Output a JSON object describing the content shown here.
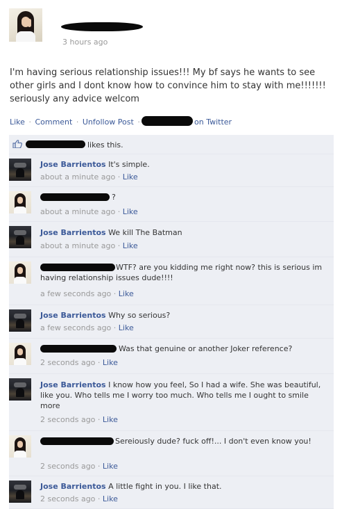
{
  "post": {
    "timestamp": "3 hours ago",
    "text": "I'm having serious relationship issues!!! My bf says he wants to see other girls and I dont know how to convince him to stay with me!!!!!!! seriously any advice welcom",
    "actions": {
      "like": "Like",
      "comment": "Comment",
      "unfollow": "Unfollow Post",
      "separator": "·",
      "twitter": "on Twitter"
    },
    "likes_text": "likes this."
  },
  "comments": [
    {
      "author": "Jose Barrientos",
      "text": "It's simple.",
      "time": "about a minute ago",
      "like": "Like"
    },
    {
      "author": "",
      "text": "?",
      "time": "about a minute ago",
      "like": "Like"
    },
    {
      "author": "Jose Barrientos",
      "text": "We kill The Batman",
      "time": "about a minute ago",
      "like": "Like"
    },
    {
      "author": "",
      "text": "WTF? are you kidding me right now? this is serious im having relationship issues dude!!!!",
      "time": "a few seconds ago",
      "like": "Like"
    },
    {
      "author": "Jose Barrientos",
      "text": "Why so serious?",
      "time": "a few seconds ago",
      "like": "Like"
    },
    {
      "author": "",
      "text": "Was that genuine or another Joker reference?",
      "time": "2 seconds ago",
      "like": "Like"
    },
    {
      "author": "Jose Barrientos",
      "text": "I know how you feel, So I had a wife. She was beautiful, like you. Who tells me I worry too much. Who tells me I ought to smile more",
      "time": "2 seconds ago",
      "like": "Like"
    },
    {
      "author": "",
      "text": "Sereiously dude? fuck off!... I don't even know you!",
      "time": "2 seconds ago",
      "like": "Like"
    },
    {
      "author": "Jose Barrientos",
      "text": "A little fight in you. I like that.",
      "time": "2 seconds ago",
      "like": "Like"
    }
  ],
  "colors": {
    "link": "#3b5998",
    "meta": "#999999",
    "comment_bg": "#edeff4",
    "redaction": "#0a0a0a"
  },
  "icons": [
    "thumbs-up-icon"
  ]
}
